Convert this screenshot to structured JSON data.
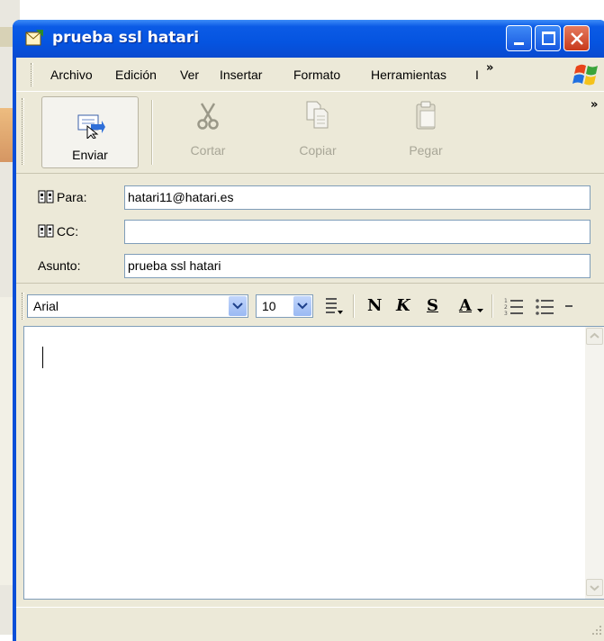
{
  "window": {
    "title": "prueba ssl hatari"
  },
  "menu": {
    "items": [
      "Archivo",
      "Edición",
      "Ver",
      "Insertar",
      "Formato",
      "Herramientas",
      "I"
    ],
    "overflow": "»"
  },
  "toolbar": {
    "send_label": "Enviar",
    "cut_label": "Cortar",
    "copy_label": "Copiar",
    "paste_label": "Pegar",
    "overflow": "»"
  },
  "headers": {
    "to_label": "Para:",
    "to_value": "hatari11@hatari.es",
    "cc_label": "CC:",
    "cc_value": "",
    "subject_label": "Asunto:",
    "subject_value": "prueba ssl hatari"
  },
  "format": {
    "font": "Arial",
    "size": "10",
    "bold": "N",
    "italic": "K",
    "underline": "S",
    "color": "A"
  },
  "icons": {
    "window": "compose-mail-icon",
    "send": "send-mail-icon",
    "cut": "scissors-icon",
    "copy": "copy-icon",
    "paste": "paste-icon"
  },
  "colors": {
    "titlebar": "#0554e0",
    "chrome": "#ece9d8",
    "input_border": "#7f9db9"
  }
}
